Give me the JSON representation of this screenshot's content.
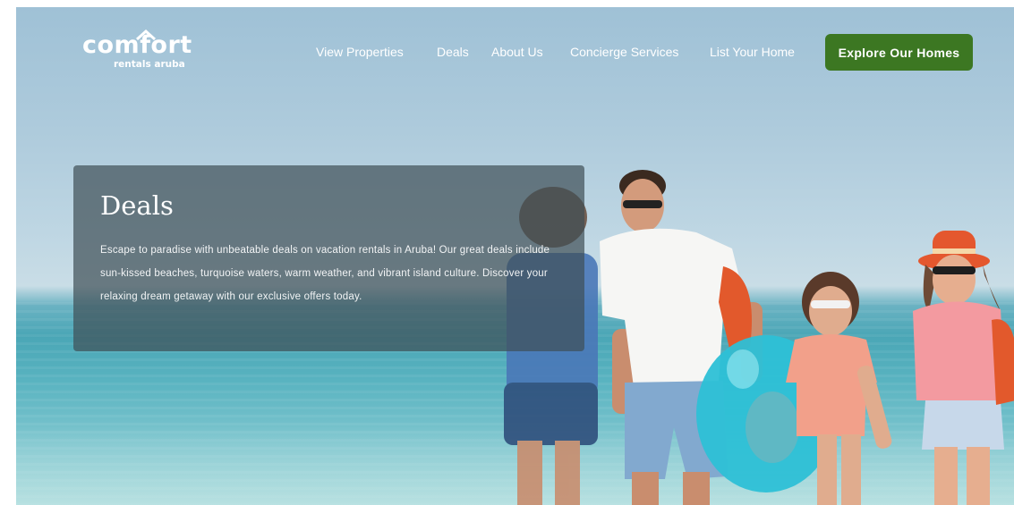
{
  "logo": {
    "main": "comfort",
    "sub": "rentals aruba"
  },
  "nav": {
    "items": [
      {
        "label": "View Properties"
      },
      {
        "label": "Deals"
      },
      {
        "label": "About Us"
      },
      {
        "label": "Concierge Services"
      },
      {
        "label": "List Your Home"
      }
    ],
    "cta_label": "Explore Our Homes"
  },
  "hero": {
    "title": "Deals",
    "description": "Escape to paradise with unbeatable deals on vacation rentals in Aruba! Our great deals include sun-kissed beaches, turquoise waters, warm weather, and vibrant island culture. Discover your relaxing dream getaway with our exclusive offers today."
  },
  "colors": {
    "cta_background": "#3c7722",
    "panel_background": "rgba(62,78,86,0.70)",
    "text": "#ffffff"
  },
  "icons": {
    "logo_roof": "house-roof-icon"
  }
}
